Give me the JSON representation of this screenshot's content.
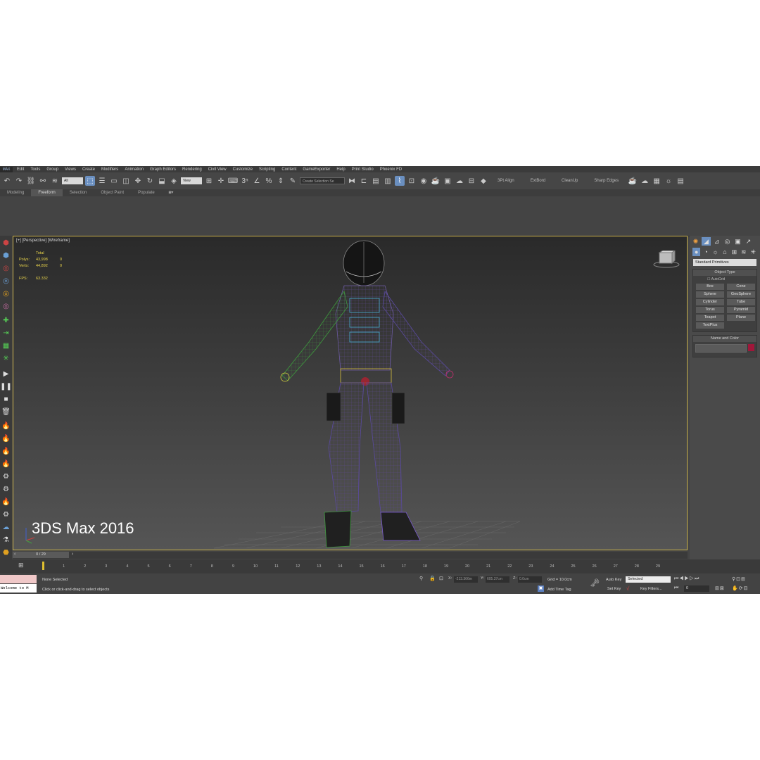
{
  "menu": {
    "logo": "MAX",
    "items": [
      "Edit",
      "Tools",
      "Group",
      "Views",
      "Create",
      "Modifiers",
      "Animation",
      "Graph Editors",
      "Rendering",
      "Civil View",
      "Customize",
      "Scripting",
      "Content",
      "GameExporter",
      "Help",
      "Print Studio",
      "Phoenix FD"
    ]
  },
  "toolbar": {
    "filter_value": "All",
    "refcoord_value": "View",
    "selection_set_placeholder": "Create Selection Se",
    "plugins": [
      "3Pt Align",
      "ExtBord",
      "CleanUp",
      "Sharp Edges"
    ]
  },
  "ribbon": {
    "tabs": [
      "Modeling",
      "Freeform",
      "Selection",
      "Object Paint",
      "Populate"
    ],
    "active_tab": "Freeform"
  },
  "viewport": {
    "label": "[+] [Perspective] [Wireframe]",
    "stats": {
      "header": "Total",
      "polys_label": "Polys:",
      "polys_value": "43,998",
      "polys_sel": "0",
      "verts_label": "Verts:",
      "verts_value": "44,892",
      "verts_sel": "0",
      "fps_label": "FPS:",
      "fps_value": "63.332"
    },
    "caption": "3DS Max 2016"
  },
  "command_panel": {
    "category": "Standard Primitives",
    "object_type_title": "Object Type",
    "autogrid_label": "AutoGrid",
    "buttons": [
      "Box",
      "Cone",
      "Sphere",
      "GeoSphere",
      "Cylinder",
      "Tube",
      "Torus",
      "Pyramid",
      "Teapot",
      "Plane",
      "TextPlus"
    ],
    "name_color_title": "Name and Color",
    "color": "#a0173a"
  },
  "timeline": {
    "slider_label": "0 / 29",
    "ticks": [
      "0",
      "1",
      "2",
      "3",
      "4",
      "5",
      "6",
      "7",
      "8",
      "9",
      "10",
      "11",
      "12",
      "13",
      "14",
      "15",
      "16",
      "17",
      "18",
      "19",
      "20",
      "21",
      "22",
      "23",
      "24",
      "25",
      "26",
      "27",
      "28",
      "29"
    ]
  },
  "status": {
    "maxscript_text": "Welcome to M",
    "selection_text": "None Selected",
    "prompt_text": "Click or click-and-drag to select objects",
    "x_label": "X:",
    "x_value": "-213.366m",
    "y_label": "Y:",
    "y_value": "605.37cm",
    "z_label": "Z:",
    "z_value": "0.0cm",
    "grid_text": "Grid = 10.0cm",
    "add_time_tag": "Add Time Tag",
    "auto_key": "Auto Key",
    "set_key": "Set Key",
    "selected_value": "Selected",
    "key_filters": "Key Filters...",
    "frame_value": "0"
  }
}
